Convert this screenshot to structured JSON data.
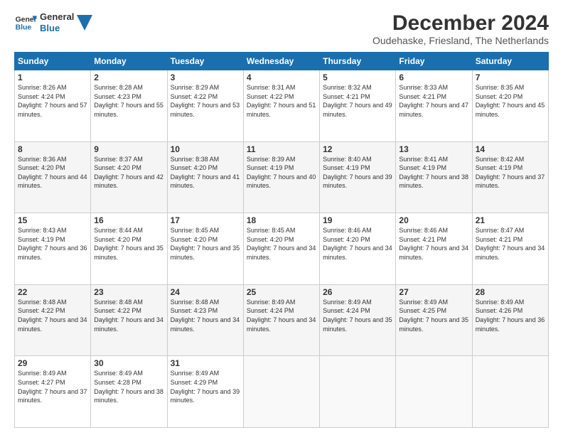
{
  "logo": {
    "line1": "General",
    "line2": "Blue"
  },
  "title": "December 2024",
  "subtitle": "Oudehaske, Friesland, The Netherlands",
  "days_of_week": [
    "Sunday",
    "Monday",
    "Tuesday",
    "Wednesday",
    "Thursday",
    "Friday",
    "Saturday"
  ],
  "weeks": [
    [
      {
        "day": 1,
        "sunrise": "8:26 AM",
        "sunset": "4:24 PM",
        "daylight": "7 hours and 57 minutes."
      },
      {
        "day": 2,
        "sunrise": "8:28 AM",
        "sunset": "4:23 PM",
        "daylight": "7 hours and 55 minutes."
      },
      {
        "day": 3,
        "sunrise": "8:29 AM",
        "sunset": "4:22 PM",
        "daylight": "7 hours and 53 minutes."
      },
      {
        "day": 4,
        "sunrise": "8:31 AM",
        "sunset": "4:22 PM",
        "daylight": "7 hours and 51 minutes."
      },
      {
        "day": 5,
        "sunrise": "8:32 AM",
        "sunset": "4:21 PM",
        "daylight": "7 hours and 49 minutes."
      },
      {
        "day": 6,
        "sunrise": "8:33 AM",
        "sunset": "4:21 PM",
        "daylight": "7 hours and 47 minutes."
      },
      {
        "day": 7,
        "sunrise": "8:35 AM",
        "sunset": "4:20 PM",
        "daylight": "7 hours and 45 minutes."
      }
    ],
    [
      {
        "day": 8,
        "sunrise": "8:36 AM",
        "sunset": "4:20 PM",
        "daylight": "7 hours and 44 minutes."
      },
      {
        "day": 9,
        "sunrise": "8:37 AM",
        "sunset": "4:20 PM",
        "daylight": "7 hours and 42 minutes."
      },
      {
        "day": 10,
        "sunrise": "8:38 AM",
        "sunset": "4:20 PM",
        "daylight": "7 hours and 41 minutes."
      },
      {
        "day": 11,
        "sunrise": "8:39 AM",
        "sunset": "4:19 PM",
        "daylight": "7 hours and 40 minutes."
      },
      {
        "day": 12,
        "sunrise": "8:40 AM",
        "sunset": "4:19 PM",
        "daylight": "7 hours and 39 minutes."
      },
      {
        "day": 13,
        "sunrise": "8:41 AM",
        "sunset": "4:19 PM",
        "daylight": "7 hours and 38 minutes."
      },
      {
        "day": 14,
        "sunrise": "8:42 AM",
        "sunset": "4:19 PM",
        "daylight": "7 hours and 37 minutes."
      }
    ],
    [
      {
        "day": 15,
        "sunrise": "8:43 AM",
        "sunset": "4:19 PM",
        "daylight": "7 hours and 36 minutes."
      },
      {
        "day": 16,
        "sunrise": "8:44 AM",
        "sunset": "4:20 PM",
        "daylight": "7 hours and 35 minutes."
      },
      {
        "day": 17,
        "sunrise": "8:45 AM",
        "sunset": "4:20 PM",
        "daylight": "7 hours and 35 minutes."
      },
      {
        "day": 18,
        "sunrise": "8:45 AM",
        "sunset": "4:20 PM",
        "daylight": "7 hours and 34 minutes."
      },
      {
        "day": 19,
        "sunrise": "8:46 AM",
        "sunset": "4:20 PM",
        "daylight": "7 hours and 34 minutes."
      },
      {
        "day": 20,
        "sunrise": "8:46 AM",
        "sunset": "4:21 PM",
        "daylight": "7 hours and 34 minutes."
      },
      {
        "day": 21,
        "sunrise": "8:47 AM",
        "sunset": "4:21 PM",
        "daylight": "7 hours and 34 minutes."
      }
    ],
    [
      {
        "day": 22,
        "sunrise": "8:48 AM",
        "sunset": "4:22 PM",
        "daylight": "7 hours and 34 minutes."
      },
      {
        "day": 23,
        "sunrise": "8:48 AM",
        "sunset": "4:22 PM",
        "daylight": "7 hours and 34 minutes."
      },
      {
        "day": 24,
        "sunrise": "8:48 AM",
        "sunset": "4:23 PM",
        "daylight": "7 hours and 34 minutes."
      },
      {
        "day": 25,
        "sunrise": "8:49 AM",
        "sunset": "4:24 PM",
        "daylight": "7 hours and 34 minutes."
      },
      {
        "day": 26,
        "sunrise": "8:49 AM",
        "sunset": "4:24 PM",
        "daylight": "7 hours and 35 minutes."
      },
      {
        "day": 27,
        "sunrise": "8:49 AM",
        "sunset": "4:25 PM",
        "daylight": "7 hours and 35 minutes."
      },
      {
        "day": 28,
        "sunrise": "8:49 AM",
        "sunset": "4:26 PM",
        "daylight": "7 hours and 36 minutes."
      }
    ],
    [
      {
        "day": 29,
        "sunrise": "8:49 AM",
        "sunset": "4:27 PM",
        "daylight": "7 hours and 37 minutes."
      },
      {
        "day": 30,
        "sunrise": "8:49 AM",
        "sunset": "4:28 PM",
        "daylight": "7 hours and 38 minutes."
      },
      {
        "day": 31,
        "sunrise": "8:49 AM",
        "sunset": "4:29 PM",
        "daylight": "7 hours and 39 minutes."
      },
      null,
      null,
      null,
      null
    ]
  ],
  "labels": {
    "sunrise": "Sunrise:",
    "sunset": "Sunset:",
    "daylight": "Daylight:"
  }
}
